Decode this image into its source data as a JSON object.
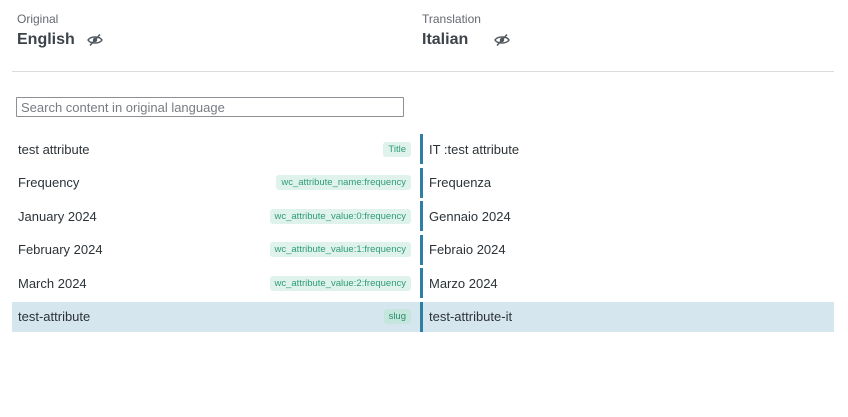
{
  "original": {
    "caption": "Original",
    "language": "English",
    "icon": "eye-slash-icon"
  },
  "translation": {
    "caption": "Translation",
    "language": "Italian",
    "icon": "eye-slash-icon"
  },
  "search": {
    "placeholder": "Search content in original language",
    "value": ""
  },
  "rows": [
    {
      "original": "test attribute",
      "tag": "Title",
      "translation": "IT :test attribute",
      "selected": false
    },
    {
      "original": "Frequency",
      "tag": "wc_attribute_name:frequency",
      "translation": "Frequenza",
      "selected": false
    },
    {
      "original": "January 2024",
      "tag": "wc_attribute_value:0:frequency",
      "translation": "Gennaio 2024",
      "selected": false
    },
    {
      "original": "February 2024",
      "tag": "wc_attribute_value:1:frequency",
      "translation": "Febraio 2024",
      "selected": false
    },
    {
      "original": "March 2024",
      "tag": "wc_attribute_value:2:frequency",
      "translation": "Marzo 2024",
      "selected": false
    },
    {
      "original": "test-attribute",
      "tag": "slug",
      "translation": "test-attribute-it",
      "selected": true
    }
  ],
  "colors": {
    "accent_bar": "#2e7fa3",
    "selected_row": "#d6e6ef",
    "tag_text": "#2f9c74",
    "tag_bg": "#dff3ec"
  }
}
